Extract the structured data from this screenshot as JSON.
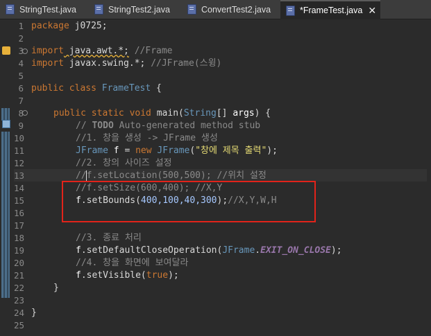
{
  "tabs": [
    {
      "label": "StringTest.java",
      "active": false
    },
    {
      "label": "StringTest2.java",
      "active": false
    },
    {
      "label": "ConvertTest2.java",
      "active": false
    },
    {
      "label": "*FrameTest.java",
      "active": true,
      "close": "✕"
    }
  ],
  "line_numbers": [
    "1",
    "2",
    "3",
    "4",
    "5",
    "6",
    "7",
    "8",
    "9",
    "10",
    "11",
    "12",
    "13",
    "14",
    "15",
    "16",
    "17",
    "18",
    "19",
    "20",
    "21",
    "22",
    "23",
    "24",
    "25"
  ],
  "code": {
    "l1_kw": "package",
    "l1_rest": " j0725;",
    "l3_kw": "import",
    "l3_pkg": " java.awt.*;",
    "l3_cmt": " //Frame",
    "l4_kw": "import",
    "l4_pkg": " javax.swing.*;",
    "l4_cmt": " //JFrame(스윙)",
    "l6_kw": "public class",
    "l6_cls": " FrameTest",
    "l6_rest": " {",
    "l8_kw": "public static void",
    "l8_fn": " main",
    "l8_p1": "(",
    "l8_cls": "String",
    "l8_p2": "[] ",
    "l8_var": "args",
    "l8_p3": ") {",
    "l9_cmt1": "// ",
    "l9_todo": "TODO",
    "l9_cmt2": " Auto-generated method stub",
    "l10_cmt": "//1. 창을 생성 -> JFrame 생성",
    "l11_cls": "JFrame",
    "l11_var": " f",
    "l11_eq": " = ",
    "l11_kw": "new",
    "l11_cls2": " JFrame",
    "l11_p": "(",
    "l11_str": "\"창에 제목 출력\"",
    "l11_end": ");",
    "l12_cmt": "//2. 창의 사이즈 설정",
    "l13_cmt": "//f.setLocation(500,500); //위치 설정",
    "l14_cmt": "//f.setSize(600,400); //X,Y",
    "l15_var": "f",
    "l15_call": ".setBounds(",
    "l15_nums": "400,100,40,300",
    "l15_end": ");",
    "l15_cmt": "//X,Y,W,H",
    "l18_cmt": "//3. 종료 처리",
    "l19_var": "f",
    "l19_call": ".setDefaultCloseOperation(",
    "l19_cls": "JFrame",
    "l19_dot": ".",
    "l19_const": "EXIT_ON_CLOSE",
    "l19_end": ");",
    "l20_cmt": "//4. 창을 화면에 보여달라",
    "l21_var": "f",
    "l21_call": ".setVisible(",
    "l21_kw": "true",
    "l21_end": ");",
    "l22_brace": "}",
    "l24_brace": "}"
  },
  "colors": {
    "background": "#2b2b2b",
    "highlight_box": "#e2231a",
    "keyword": "#cc7832",
    "class": "#6897bb",
    "string": "#e6db74",
    "comment": "#8a8a8a"
  },
  "icons": [
    "java-file-icon",
    "close-icon",
    "warning-icon",
    "override-icon",
    "fold-icon"
  ]
}
